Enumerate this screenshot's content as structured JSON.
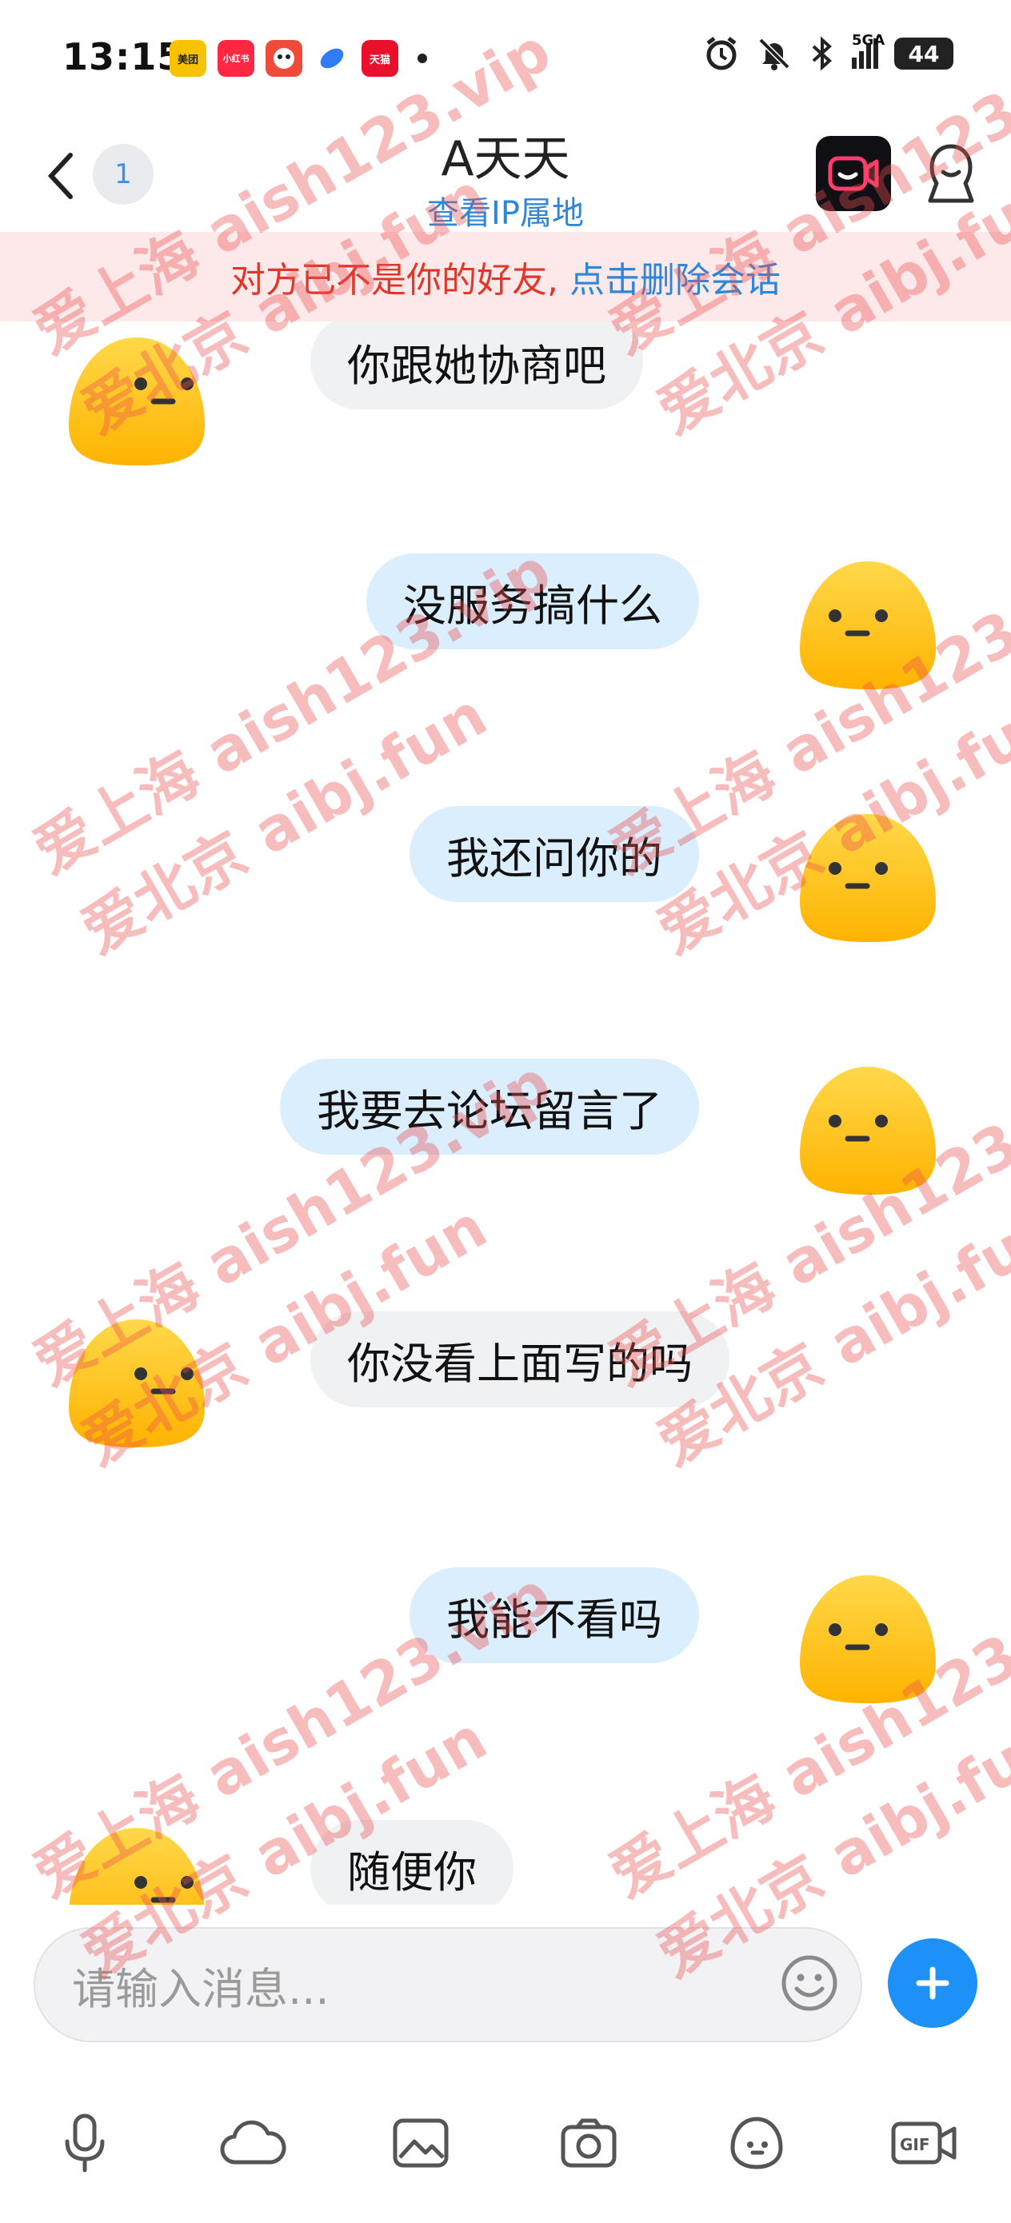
{
  "status_bar": {
    "time": "13:15",
    "apps": [
      {
        "name": "meituan-icon",
        "label": "美团",
        "color": "#f7c300"
      },
      {
        "name": "xiaohongshu-icon",
        "label": "小红书",
        "color": "#ff2742"
      },
      {
        "name": "game-app-icon",
        "label": "",
        "color": "#f04b3a"
      },
      {
        "name": "browser-app-icon",
        "label": "",
        "color": "#2f7cf6"
      },
      {
        "name": "tmall-icon",
        "label": "天猫",
        "color": "#e8102a"
      }
    ],
    "network_label": "5GA",
    "battery": "44"
  },
  "header": {
    "unread_count": "1",
    "title": "A天天",
    "ip_link": "查看IP属地"
  },
  "banner": {
    "warning": "对方已不是你的好友,",
    "action": "点击删除会话"
  },
  "messages": [
    {
      "side": "left",
      "text": "你跟她协商吧"
    },
    {
      "side": "right",
      "text": "没服务搞什么"
    },
    {
      "side": "right",
      "text": "我还问你的"
    },
    {
      "side": "right",
      "text": "我要去论坛留言了"
    },
    {
      "side": "left",
      "text": "你没看上面写的吗"
    },
    {
      "side": "right",
      "text": "我能不看吗"
    },
    {
      "side": "left",
      "text": "随便你"
    }
  ],
  "input": {
    "placeholder": "请输入消息..."
  },
  "toolbar": [
    "microphone-icon",
    "cloud-icon",
    "image-icon",
    "camera-icon",
    "sticker-icon",
    "gif-icon"
  ],
  "watermarks": [
    "爱上海 aish123.vip",
    "爱北京 aibj.fun"
  ],
  "colors": {
    "accent": "#1d91f7",
    "link": "#2d86d8",
    "warning": "#e2362a",
    "banner_bg": "#fde9e9",
    "bubble_left": "#f0f1f3",
    "bubble_right": "#dbeefd"
  }
}
